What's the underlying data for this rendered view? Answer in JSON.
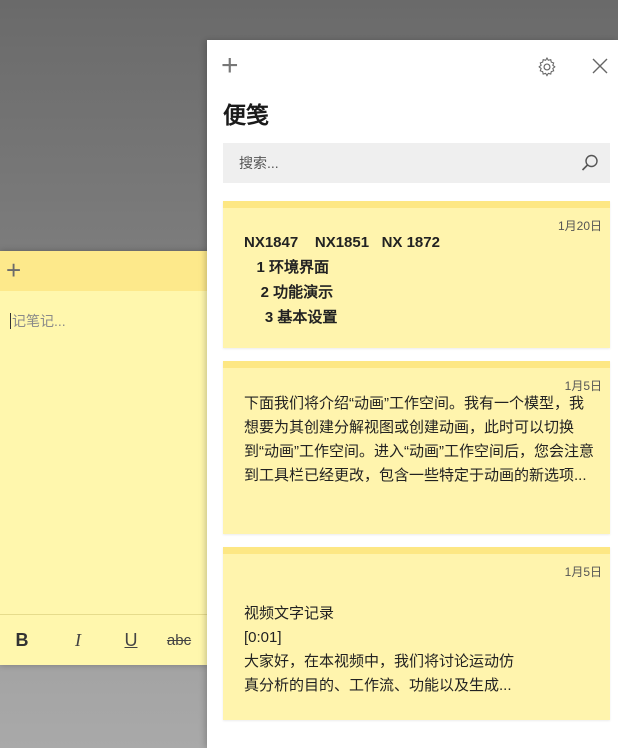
{
  "editor": {
    "placeholder": "记笔记...",
    "format": {
      "bold": "B",
      "italic": "I",
      "underline": "U",
      "strike": "abc"
    }
  },
  "panel": {
    "title": "便笺",
    "search_placeholder": "搜索...",
    "notes": [
      {
        "date": "1月20日",
        "lines": [
          "NX1847    NX1851   NX 1872",
          "   1 环境界面",
          "    2 功能演示",
          "     3 基本设置"
        ]
      },
      {
        "date": "1月5日",
        "text": "下面我们将介绍“动画”工作空间。我有一个模型，我想要为其创建分解视图或创建动画，此时可以切换到“动画”工作空间。进入“动画”工作空间后，您会注意到工具栏已经更改，包含一些特定于动画的新选项..."
      },
      {
        "date": "1月5日",
        "lines": [
          "视频文字记录",
          "[0:01]",
          "大家好，在本视频中，我们将讨论运动仿",
          "真分析的目的、工作流、功能以及生成..."
        ]
      }
    ]
  },
  "colors": {
    "note_yellow": "#fff4ad",
    "note_strip": "#fde784"
  }
}
